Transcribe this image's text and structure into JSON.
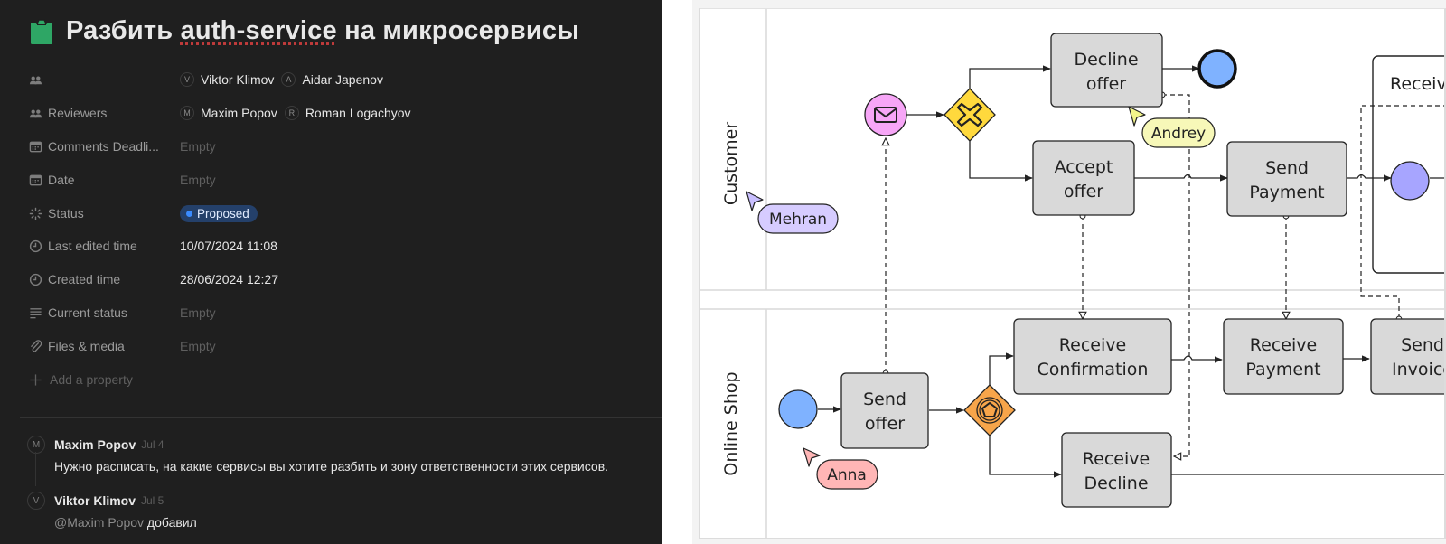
{
  "page": {
    "title_icon": "clipboard-icon",
    "title_parts": [
      "Разбить ",
      "auth-service",
      " на микросервисы"
    ]
  },
  "properties": {
    "assignees": {
      "icon": "people-icon",
      "label": "",
      "people": [
        {
          "initial": "V",
          "name": "Viktor Klimov"
        },
        {
          "initial": "A",
          "name": "Aidar Japenov"
        }
      ]
    },
    "reviewers": {
      "icon": "people-icon",
      "label": "Reviewers",
      "people": [
        {
          "initial": "M",
          "name": "Maxim Popov"
        },
        {
          "initial": "R",
          "name": "Roman Logachyov"
        }
      ]
    },
    "comments_deadline": {
      "icon": "calendar-icon",
      "label": "Comments Deadli...",
      "value": "Empty"
    },
    "date": {
      "icon": "calendar-icon",
      "label": "Date",
      "value": "Empty"
    },
    "status": {
      "icon": "status-spinner-icon",
      "label": "Status",
      "value": "Proposed",
      "color": "#3a8bff"
    },
    "last_edited": {
      "icon": "clock-icon",
      "label": "Last edited time",
      "value": "10/07/2024 11:08"
    },
    "created": {
      "icon": "clock-icon",
      "label": "Created time",
      "value": "28/06/2024 12:27"
    },
    "current_status": {
      "icon": "text-lines-icon",
      "label": "Current status",
      "value": "Empty"
    },
    "files": {
      "icon": "paperclip-icon",
      "label": "Files & media",
      "value": "Empty"
    },
    "add_property": {
      "icon": "plus-icon",
      "label": "Add a property"
    }
  },
  "comments": [
    {
      "initial": "M",
      "author": "Maxim Popov",
      "date": "Jul 4",
      "mention": "",
      "text": "Нужно расписать, на какие сервисы вы хотите разбить и зону ответственности этих сервисов."
    },
    {
      "initial": "V",
      "author": "Viktor Klimov",
      "date": "Jul 5",
      "mention": "@Maxim Popov",
      "text": " добавил"
    }
  ],
  "diagram": {
    "lanes": [
      "Customer",
      "Online Shop"
    ],
    "tasks": {
      "decline_offer": [
        "Decline",
        "offer"
      ],
      "accept_offer": [
        "Accept",
        "offer"
      ],
      "send_payment": [
        "Send",
        "Payment"
      ],
      "receive_confirmation": [
        "Receive",
        "Confirmation"
      ],
      "receive_payment": [
        "Receive",
        "Payment"
      ],
      "send_invoice": [
        "Send",
        "Invoice"
      ],
      "send_offer": [
        "Send",
        "offer"
      ],
      "receive_decline": [
        "Receive",
        "Decline"
      ]
    },
    "subprocess_label": "Receive",
    "cursors": [
      {
        "name": "Mehran",
        "color": "#d6ccff"
      },
      {
        "name": "Andrey",
        "color": "#f7f8b8"
      },
      {
        "name": "Anna",
        "color": "#ffb6b6"
      }
    ],
    "colors": {
      "task_fill": "#d9d9d9",
      "start_event": "#7fb2ff",
      "message_event": "#f7a6f7",
      "xor_gateway": "#ffd93d",
      "event_gateway": "#f7a54a",
      "intermediate_event": "#a7a5ff"
    }
  }
}
